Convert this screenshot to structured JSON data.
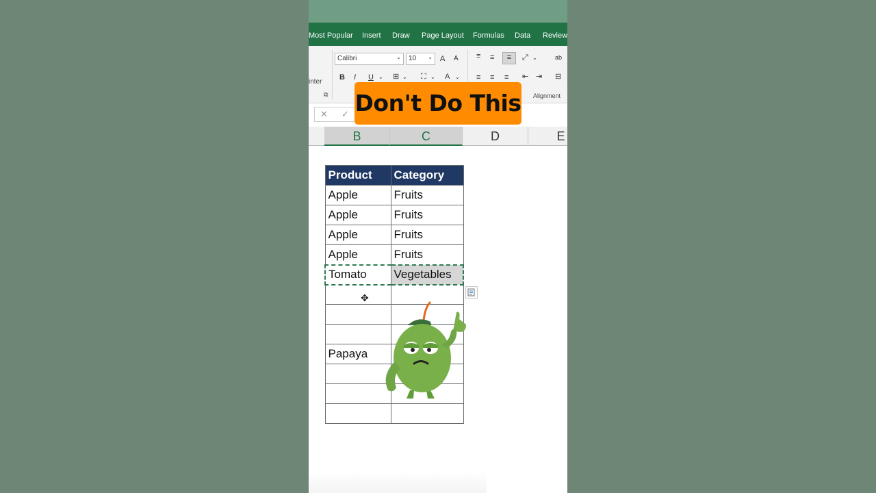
{
  "banner": {
    "text": "Don't Do This",
    "color": "#ff8c00"
  },
  "ribbon": {
    "tabs": [
      "Most Popular",
      "Insert",
      "Draw",
      "Page Layout",
      "Formulas",
      "Data",
      "Review"
    ],
    "font_name": "Calibri",
    "font_size": "10",
    "grow_font": "A",
    "shrink_font": "A",
    "bold": "B",
    "italic": "I",
    "underline": "U",
    "font_color": "A",
    "clipboard_label_fragment": "inter",
    "alignment_label": "Alignment",
    "accent": "#217346"
  },
  "formula_bar": {
    "cancel": "✕",
    "enter": "✓"
  },
  "columns": [
    "B",
    "C",
    "D",
    "E"
  ],
  "table": {
    "headers": [
      "Product",
      "Category"
    ],
    "header_bg": "#1f3864",
    "rows": [
      [
        "Apple",
        "Fruits"
      ],
      [
        "Apple",
        "Fruits"
      ],
      [
        "Apple",
        "Fruits"
      ],
      [
        "Apple",
        "Fruits"
      ],
      [
        "Tomato",
        "Vegetables"
      ],
      [
        "",
        ""
      ],
      [
        "",
        ""
      ],
      [
        "",
        ""
      ],
      [
        "Papaya",
        ""
      ],
      [
        "",
        ""
      ],
      [
        "",
        ""
      ],
      [
        "",
        ""
      ]
    ]
  },
  "icons": {
    "paste_options": "paste-options-icon",
    "cursor": "cell-cursor-icon",
    "mascot": "green-apple-mascot"
  }
}
